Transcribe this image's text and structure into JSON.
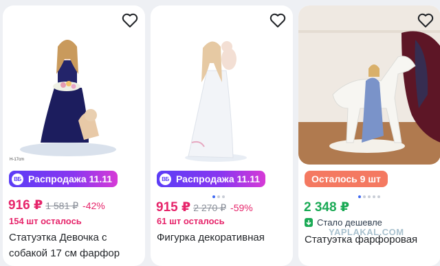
{
  "products": [
    {
      "badge": "Распродажа 11.11",
      "badge_icon": "ВБ",
      "price": "916 ₽",
      "old_price": "1 581 ₽",
      "discount": "-42%",
      "stock": "154 шт осталось",
      "title_line1": "Статуэтка Девочка с",
      "title_line2": "собакой 17 см фарфор",
      "image_note": "H-17cm",
      "image": "porcelain-girl-with-dog-figurine"
    },
    {
      "badge": "Распродажа 11.11",
      "badge_icon": "ВБ",
      "price": "915 ₽",
      "old_price": "2 270 ₽",
      "discount": "-59%",
      "stock": "61 шт осталось",
      "title_line1": "Фигурка декоративная",
      "title_line2": "",
      "image": "porcelain-woman-with-child-figurine"
    },
    {
      "badge": "Осталось 9 шт",
      "price": "2 348 ₽",
      "cheaper_label": "Стало дешевле",
      "title_line1": "Статуэтка фарфоровая",
      "title_line2": "",
      "image": "porcelain-girl-with-white-horse"
    }
  ],
  "watermark": "YAPLAKAL.COM",
  "colors": {
    "sale_gradient_start": "#5b3df6",
    "sale_gradient_end": "#d63ad6",
    "price_red": "#e6246a",
    "price_green": "#1aaa55",
    "badge_orange": "#f47961"
  }
}
